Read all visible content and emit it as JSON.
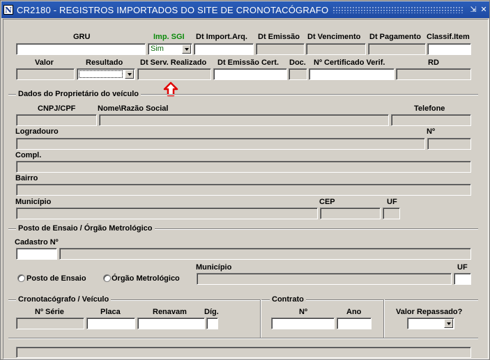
{
  "window": {
    "title": "CR2180 - REGISTROS IMPORTADOS DO SITE DE CRONOTACÓGRAFO",
    "minimize_glyph": "⇲",
    "close_glyph": "✕"
  },
  "row1": {
    "gru": "GRU",
    "imp_sgi": "Imp. SGI",
    "imp_sgi_value": "Sim",
    "dt_import": "Dt Import.Arq.",
    "dt_emissao": "Dt Emissão",
    "dt_vencimento": "Dt Vencimento",
    "dt_pagamento": "Dt Pagamento",
    "classif_item": "Classif.Item"
  },
  "row2": {
    "valor": "Valor",
    "resultado": "Resultado",
    "dt_serv_realizado": "Dt Serv. Realizado",
    "dt_emissao_cert": "Dt Emissão Cert.",
    "doc": "Doc.",
    "n_certificado": "Nº Certificado Verif.",
    "rd": "RD"
  },
  "proprietario": {
    "section": "Dados do Proprietário do veículo",
    "cnpj": "CNPJ/CPF",
    "nome": "Nome\\Razão Social",
    "telefone": "Telefone",
    "logradouro": "Logradouro",
    "numero": "Nº",
    "compl": "Compl.",
    "bairro": "Bairro",
    "municipio": "Município",
    "cep": "CEP",
    "uf": "UF"
  },
  "posto": {
    "section": "Posto de Ensaio / Órgão Metrológico",
    "cadastro": "Cadastro Nº",
    "municipio": "Município",
    "uf": "UF",
    "radio_posto": "Posto de Ensaio",
    "radio_orgao": "Órgão Metrológico"
  },
  "cronotacografo": {
    "section": "Cronotacógrafo / Veículo",
    "n_serie": "Nº Série",
    "placa": "Placa",
    "renavam": "Renavam",
    "dig": "Díg."
  },
  "contrato": {
    "section": "Contrato",
    "numero": "Nº",
    "ano": "Ano"
  },
  "valor_repassado": {
    "label": "Valor Repassado?"
  },
  "colors": {
    "title_bar": "#1e4aa3",
    "highlight_label": "#0a8a0a",
    "marker_arrow": "#e00000"
  }
}
